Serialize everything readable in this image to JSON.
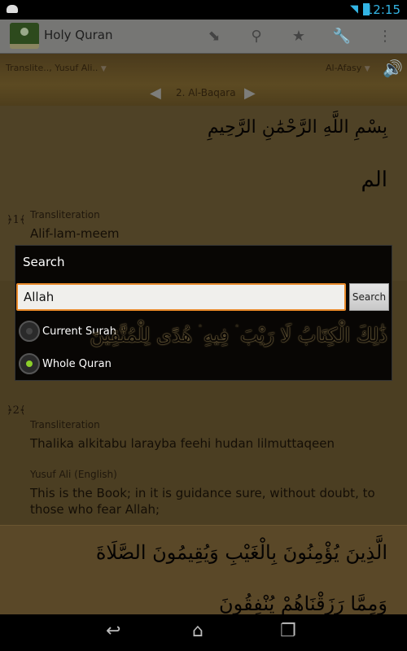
{
  "status_bar": {
    "time": "12:15"
  },
  "action_bar": {
    "title": "Holy Quran",
    "icons": [
      "download-icon",
      "search-icon",
      "star-icon",
      "wrench-icon",
      "overflow-menu-icon"
    ]
  },
  "toolbar": {
    "translation_select": "Translite.., Yusuf Ali..",
    "reciter_select": "Al-Afasy",
    "surah": "2. Al-Baqara"
  },
  "content": {
    "bismillah": "بِسْمِ اللَّهِ الرَّحْمَٰنِ الرَّحِيمِ",
    "verses": [
      {
        "number": "1",
        "arabic": "الم",
        "transliteration_label": "Transliteration",
        "transliteration": "Alif-lam-meem"
      },
      {
        "number": "2",
        "arabic": "ذَٰلِكَ الْكِتَابُ لَا رَيْبَ ۛ فِيهِ ۛ هُدًى لِلْمُتَّقِينَ",
        "transliteration_label": "Transliteration",
        "transliteration": "Thalika alkitabu larayba feehi hudan lilmuttaqeen",
        "translation_label": "Yusuf Ali (English)",
        "translation": "This is the Book; in it is guidance sure, without doubt, to those who fear Allah;"
      },
      {
        "arabic": "الَّذِينَ يُؤْمِنُونَ بِالْغَيْبِ وَيُقِيمُونَ الصَّلَاةَ",
        "arabic2": "وَمِمَّا رَزَقْنَاهُمْ يُنْفِقُونَ"
      }
    ]
  },
  "dialog": {
    "title": "Search",
    "query": "Allah",
    "search_button": "Search",
    "options": [
      {
        "label": "Current Surah",
        "selected": false
      },
      {
        "label": "Whole Quran",
        "selected": true
      }
    ],
    "accent": "#8ccf2a"
  }
}
